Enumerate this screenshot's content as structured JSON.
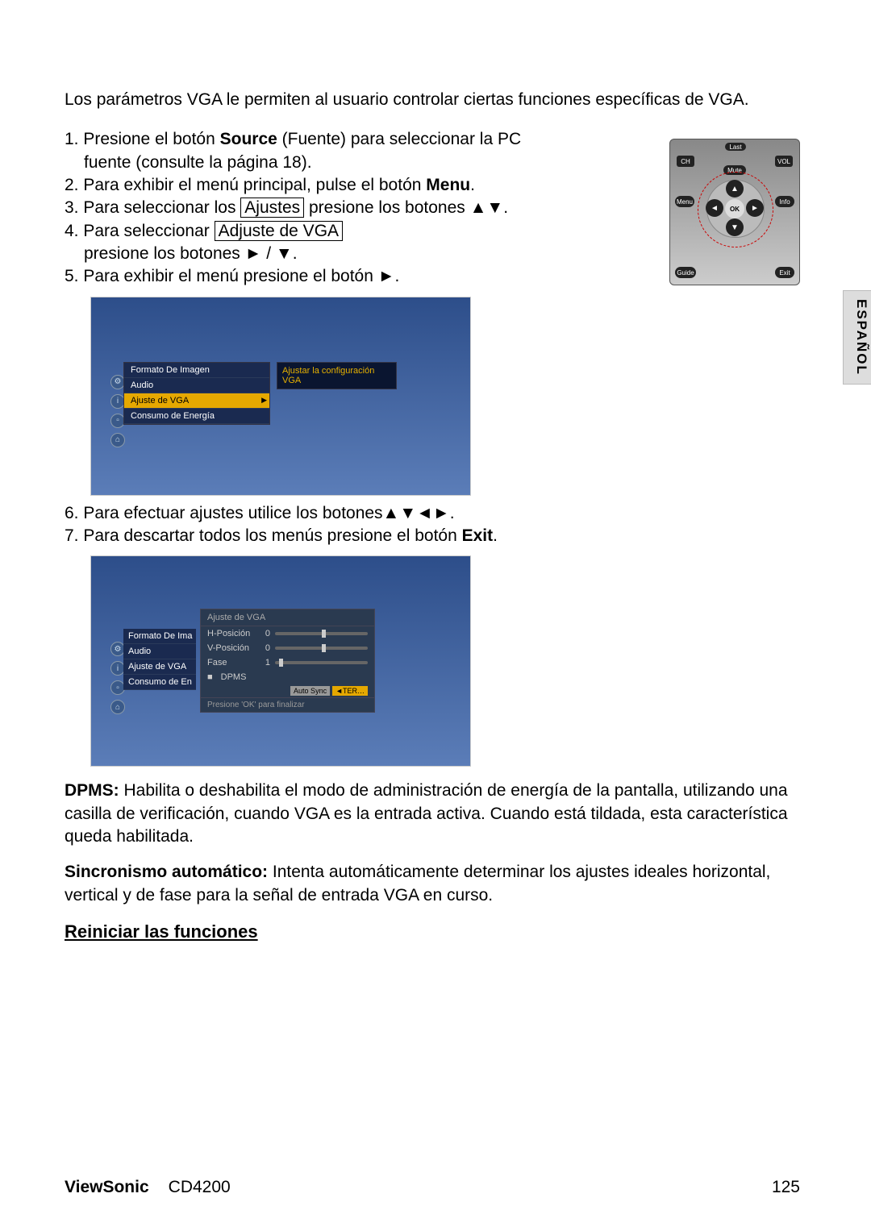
{
  "intro": "Los parámetros VGA le permiten al usuario controlar ciertas funciones específicas de VGA.",
  "steps1": {
    "s1a": "1. Presione el botón ",
    "s1b": "Source",
    "s1c": " (Fuente) para seleccionar la PC",
    "s1_line2": "fuente (consulte la página 18).",
    "s2a": "2. Para exhibir el menú principal, pulse el botón ",
    "s2b": "Menu",
    "s2c": ".",
    "s3a": "3. Para seleccionar los ",
    "s3box": "Ajustes",
    "s3b": " presione los botones ▲▼.",
    "s4a": "4. Para seleccionar ",
    "s4box": "Adjuste de VGA",
    "s4_line2": "presione los botones ► / ▼.",
    "s5": "5. Para exhibir el menú presione el botón ►."
  },
  "remote": {
    "ch": "CH",
    "vol": "VOL",
    "menu": "Menu",
    "info": "Info",
    "guide": "Guide",
    "exit": "Exit",
    "mute": "Mute",
    "last": "Last",
    "ok": "OK"
  },
  "menu1": {
    "r1": "Formato De Imagen",
    "r2": "Audio",
    "r3": "Ajuste de VGA",
    "r4": "Consumo de Energía"
  },
  "tooltip": "Ajustar la configuración VGA",
  "steps2": {
    "s6": "6. Para efectuar ajustes utilice los botones▲▼◄►.",
    "s7a": "7. Para descartar todos los menús presione el botón ",
    "s7b": "Exit",
    "s7c": "."
  },
  "menu2": {
    "r1": "Formato De Ima",
    "r2": "Audio",
    "r3": "Ajuste de VGA",
    "r4": "Consumo de En"
  },
  "panel": {
    "title": "Ajuste de VGA",
    "hpos": "H-Posición",
    "hval": "0",
    "vpos": "V-Posición",
    "vval": "0",
    "fase": "Fase",
    "fval": "1",
    "dpms": "DPMS",
    "auto": "Auto Sync",
    "ter": "TER…",
    "foot": "Presione 'OK' para finalizar"
  },
  "dpms": {
    "lbl": "DPMS: ",
    "txt": "Habilita o deshabilita el modo de administración de energía de la pantalla, utilizando una casilla de verificación, cuando VGA es la entrada activa. Cuando está tildada, esta característica queda habilitada."
  },
  "sync": {
    "lbl": "Sincronismo automático: ",
    "txt": "Intenta automáticamente determinar los ajustes ideales horizontal, vertical y de fase para la señal de entrada VGA en curso."
  },
  "h2": "Reiniciar las funciones",
  "side": "ESPAÑOL",
  "footer": {
    "brand": "ViewSonic",
    "model": "CD4200",
    "page": "125"
  }
}
